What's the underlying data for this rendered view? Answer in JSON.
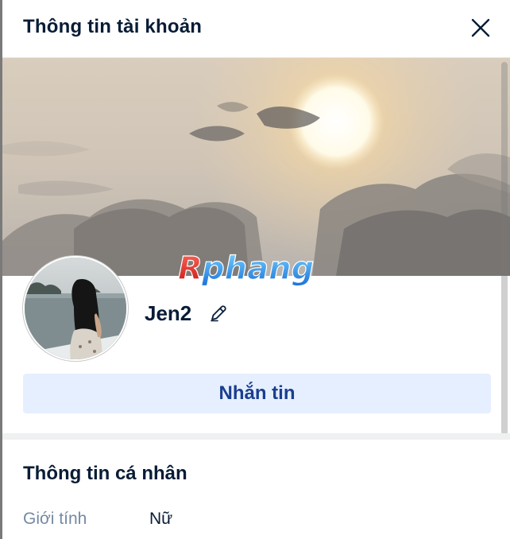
{
  "dialog": {
    "title": "Thông tin tài khoản",
    "close_icon": "close-icon"
  },
  "profile": {
    "cover_image": "sunset-clouds-over-sea",
    "avatar_image": "woman-facing-sea",
    "watermark_text": "Rphang",
    "username": "Jen2",
    "edit_icon": "pencil-icon",
    "message_label": "Nhắn tin"
  },
  "personal_info": {
    "title": "Thông tin cá nhân",
    "fields": [
      {
        "label": "Giới tính",
        "value": "Nữ"
      }
    ]
  },
  "colors": {
    "primary_text": "#081c36",
    "secondary_text": "#7589a3",
    "message_button_bg": "#e5efff",
    "message_button_text": "#1a3e8f"
  }
}
